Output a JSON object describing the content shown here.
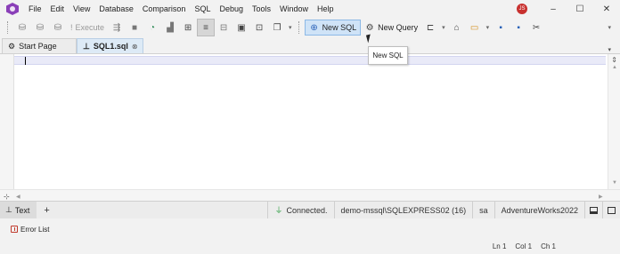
{
  "menu": {
    "items": [
      "File",
      "Edit",
      "View",
      "Database",
      "Comparison",
      "SQL",
      "Debug",
      "Tools",
      "Window",
      "Help"
    ],
    "avatar_initials": "JS"
  },
  "toolbar": {
    "execute_label": "Execute",
    "new_sql_label": "New SQL",
    "new_query_label": "New Query"
  },
  "tabs": [
    {
      "label": "Start Page"
    },
    {
      "label": "SQL1.sql"
    }
  ],
  "tooltip": {
    "text": "New SQL"
  },
  "editor_status": {
    "text_tab_label": "Text",
    "connection_status": "Connected.",
    "server": "demo-mssql\\SQLEXPRESS02 (16)",
    "user": "sa",
    "database": "AdventureWorks2022"
  },
  "error_list": {
    "label": "Error List"
  },
  "status": {
    "line": "Ln 1",
    "col": "Col 1",
    "ch": "Ch 1"
  },
  "colors": {
    "accent": "#8a3fb8",
    "selection": "#cfe3f7",
    "connected": "#2e9e44"
  }
}
